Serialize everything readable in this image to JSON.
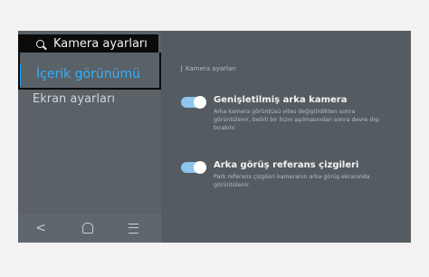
{
  "search": {
    "text": "Kamera ayarları",
    "icon": "search-icon"
  },
  "sidebar": {
    "items": [
      {
        "label": "İçerik görünümü",
        "selected": true
      },
      {
        "label": "Ekran ayarları",
        "selected": false
      }
    ],
    "accent_color": "#1ea7ff"
  },
  "navbar": {
    "icons": [
      "back-icon",
      "home-icon",
      "menu-icon"
    ]
  },
  "content": {
    "breadcrumb": "Kamera ayarları",
    "settings": [
      {
        "title": "Genişletilmiş arka kamera",
        "description": "Arka kamera görüntüsü vites değiştirdikten sonra görüntülenir, belirli bir hızın aşılmasından sonra devre dışı bırakılır.",
        "enabled": true
      },
      {
        "title": "Arka görüş referans çizgileri",
        "description": "Park referans çizgileri kameranın arka görüş ekranında görüntülenir.",
        "enabled": true
      }
    ]
  },
  "colors": {
    "screen_bg": "#545b61",
    "toggle_on": "#8ec6ee",
    "page_bg": "#f4f1f2"
  }
}
